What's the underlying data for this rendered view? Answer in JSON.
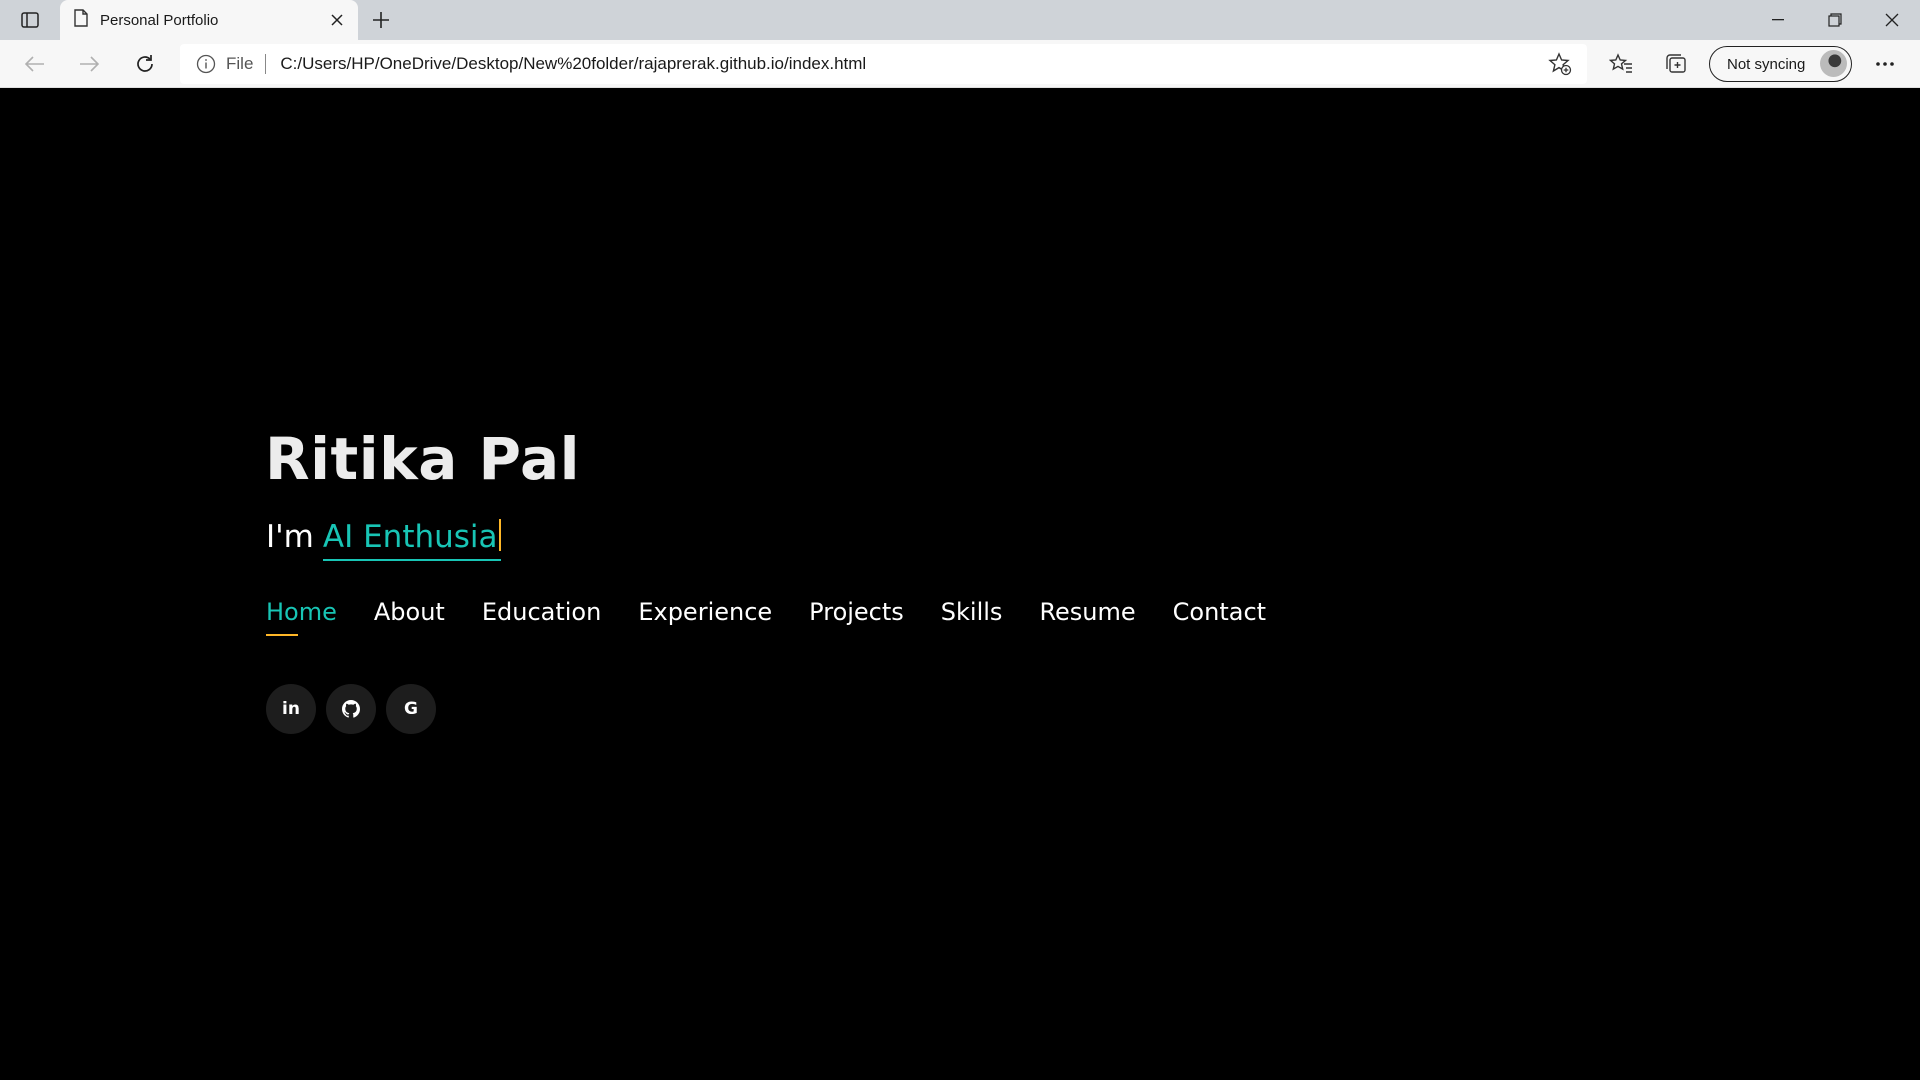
{
  "browser": {
    "tab_title": "Personal Portfolio",
    "file_label": "File",
    "url": "C:/Users/HP/OneDrive/Desktop/New%20folder/rajaprerak.github.io/index.html",
    "sync_label": "Not syncing"
  },
  "hero": {
    "name": "Ritika Pal",
    "intro_prefix": "I'm",
    "typed_text": "AI Enthusia"
  },
  "nav": {
    "items": [
      {
        "label": "Home",
        "active": true
      },
      {
        "label": "About"
      },
      {
        "label": "Education"
      },
      {
        "label": "Experience"
      },
      {
        "label": "Projects"
      },
      {
        "label": "Skills"
      },
      {
        "label": "Resume"
      },
      {
        "label": "Contact"
      }
    ]
  },
  "socials": [
    {
      "icon": "linkedin-icon",
      "glyph": "in"
    },
    {
      "icon": "github-icon"
    },
    {
      "icon": "google-icon",
      "glyph": "G"
    }
  ],
  "colors": {
    "accent": "#18c5b5",
    "cursor": "#ffb727",
    "background": "#000000"
  }
}
